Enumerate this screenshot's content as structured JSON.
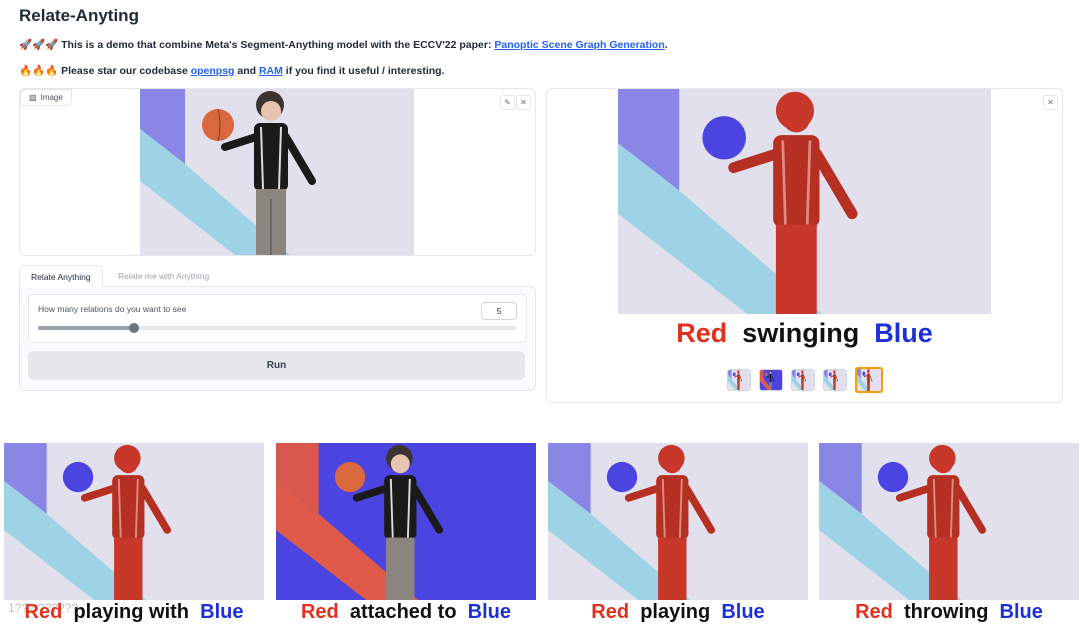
{
  "app": {
    "title": "Relate-Anyting"
  },
  "intro": {
    "line1_prefix": "🚀🚀🚀 This is a demo that combine Meta's Segment-Anything model with the ECCV'22 paper: ",
    "line1_link": "Panoptic Scene Graph Generation",
    "line1_suffix": ".",
    "line2_prefix": "🔥🔥🔥 Please star our codebase ",
    "line2_link1": "openpsg",
    "line2_and": " and ",
    "line2_link2": "RAM",
    "line2_suffix": " if you find it useful / interesting."
  },
  "image_input": {
    "label": "Image",
    "edit_icon": "pencil-icon",
    "close_icon": "close-icon"
  },
  "tabs": [
    {
      "label": "Relate Anything",
      "selected": true
    },
    {
      "label": "Relate me with Anything",
      "selected": false
    }
  ],
  "slider": {
    "label": "How many relations do you want to see",
    "value": "5",
    "fraction": 0.2
  },
  "run_button": {
    "label": "Run"
  },
  "output": {
    "subject": "Red",
    "relation": "swinging",
    "object": "Blue",
    "gallery_count": 5,
    "selected_index": 4
  },
  "strips": [
    {
      "subject": "Red",
      "relation": "playing with",
      "object": "Blue",
      "variant": "person-red"
    },
    {
      "subject": "Red",
      "relation": "attached to",
      "object": "Blue",
      "variant": "bg-blue"
    },
    {
      "subject": "Red",
      "relation": "playing",
      "object": "Blue",
      "variant": "person-red"
    },
    {
      "subject": "Red",
      "relation": "throwing",
      "object": "Blue",
      "variant": "person-red"
    }
  ],
  "watermark": "1??? ??????",
  "colors": {
    "red_mask": "#c7372a",
    "blue_mask": "#4b44e0",
    "background": "#e2e0ec",
    "stripe_light": "#9ed3e6",
    "stripe_dark": "#8a86e6",
    "link": "#2563eb",
    "accent_selected": "#f59e0b"
  }
}
